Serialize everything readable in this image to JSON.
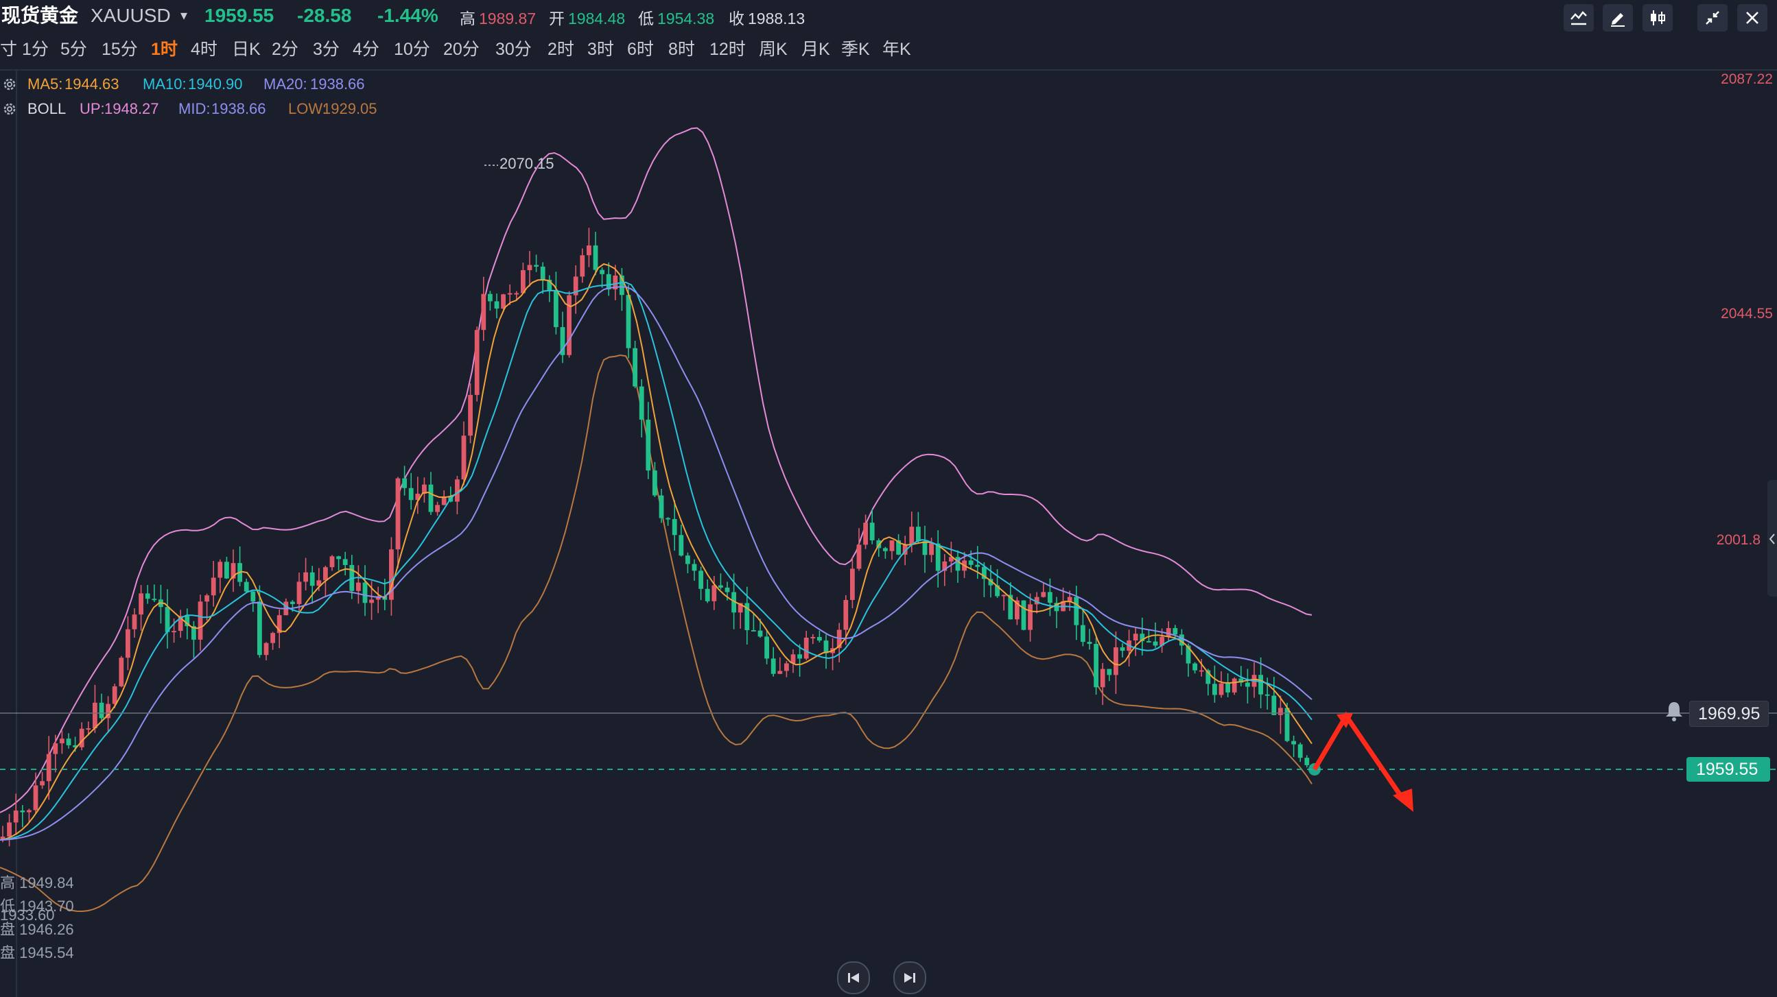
{
  "header": {
    "name": "现货黄金",
    "code": "XAUUSD",
    "dropdown": "▾",
    "price": "1959.55",
    "change": "-28.58",
    "change_pct": "-1.44%",
    "high_label": "高",
    "high": "1989.87",
    "open_label": "开",
    "open": "1984.48",
    "low_label": "低",
    "low": "1954.38",
    "close_label": "收",
    "close": "1988.13"
  },
  "timeframes": [
    "寸",
    "1分",
    "5分",
    "15分",
    "1时",
    "4时",
    "日K",
    "2分",
    "3分",
    "4分",
    "10分",
    "20分",
    "30分",
    "2时",
    "3时",
    "6时",
    "8时",
    "12时",
    "周K",
    "月K",
    "季K",
    "年K"
  ],
  "active_timeframe": "1时",
  "indicators": {
    "ma": {
      "ma5_label": "MA5:",
      "ma5": "1944.63",
      "ma10_label": "MA10:",
      "ma10": "1940.90",
      "ma20_label": "MA20:",
      "ma20": "1938.66"
    },
    "boll": {
      "name": "BOLL",
      "up_label": "UP:",
      "up": "1948.27",
      "mid_label": "MID:",
      "mid": "1938.66",
      "low_label": "LOW:",
      "low": "1929.05"
    }
  },
  "price_axis": [
    "2087.22",
    "2044.55",
    "2001.8"
  ],
  "max_label": "2070.15",
  "crosshair_price": "1969.95",
  "current_price": "1959.55",
  "lower_info": [
    "高 1949.84",
    "低 1943.70",
    "1933.60",
    "盘 1946.26",
    "盘 1945.54"
  ],
  "colors": {
    "up": "#e05a6a",
    "down": "#22c08a",
    "ma5": "#f2a33a",
    "ma10": "#29c4e0",
    "ma20": "#8f8ff2",
    "boll_up": "#e58ad8",
    "boll_low": "#b87840",
    "arrow": "#ff2a1a"
  },
  "icons": [
    "chart-settings-icon",
    "draw-icon",
    "candle-type-icon",
    "collapse-icon",
    "close-icon",
    "rewind-icon",
    "forward-icon",
    "bell-icon",
    "gear-icon"
  ]
}
